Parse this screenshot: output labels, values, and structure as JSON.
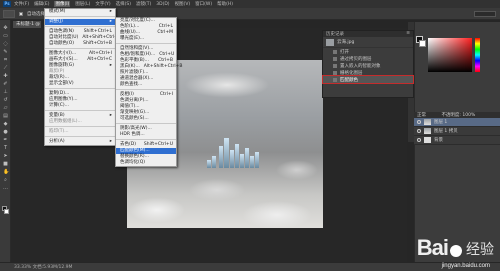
{
  "menubar": {
    "logo": "Ps",
    "items": [
      "文件(F)",
      "编辑(E)",
      "图像(I)",
      "图层(L)",
      "文字(Y)",
      "选择(S)",
      "滤镜(T)",
      "3D(D)",
      "视图(V)",
      "窗口(W)",
      "帮助(H)"
    ]
  },
  "optionsbar": {
    "auto_select_label": "自动选择:",
    "show_transform_label": "显示变换控件"
  },
  "document_tab": {
    "label": "未标题-1 @ 33.3%"
  },
  "image_menu": {
    "rows": [
      {
        "label": "模式(M)",
        "submenu": true
      },
      {
        "sep": true
      },
      {
        "label": "调整(J)",
        "submenu": true,
        "highlight": true
      },
      {
        "sep": true
      },
      {
        "label": "自动色调(N)",
        "shortcut": "Shift+Ctrl+L"
      },
      {
        "label": "自动对比度(U)",
        "shortcut": "Alt+Shift+Ctrl+L"
      },
      {
        "label": "自动颜色(O)",
        "shortcut": "Shift+Ctrl+B"
      },
      {
        "sep": true
      },
      {
        "label": "图像大小(I)...",
        "shortcut": "Alt+Ctrl+I"
      },
      {
        "label": "画布大小(S)...",
        "shortcut": "Alt+Ctrl+C"
      },
      {
        "label": "图像旋转(G)",
        "submenu": true
      },
      {
        "label": "裁剪(P)",
        "disabled": true
      },
      {
        "label": "裁切(R)..."
      },
      {
        "label": "显示全部(V)"
      },
      {
        "sep": true
      },
      {
        "label": "复制(D)..."
      },
      {
        "label": "应用图像(Y)..."
      },
      {
        "label": "计算(C)..."
      },
      {
        "sep": true
      },
      {
        "label": "变量(B)",
        "submenu": true
      },
      {
        "label": "应用数据组(L)...",
        "disabled": true
      },
      {
        "sep": true
      },
      {
        "label": "陷印(T)...",
        "disabled": true
      },
      {
        "sep": true
      },
      {
        "label": "分析(A)",
        "submenu": true
      }
    ]
  },
  "adjust_menu": {
    "rows": [
      {
        "label": "亮度/对比度(C)..."
      },
      {
        "label": "色阶(L)...",
        "shortcut": "Ctrl+L"
      },
      {
        "label": "曲线(U)...",
        "shortcut": "Ctrl+M"
      },
      {
        "label": "曝光度(E)..."
      },
      {
        "sep": true
      },
      {
        "label": "自然饱和度(V)..."
      },
      {
        "label": "色相/饱和度(H)...",
        "shortcut": "Ctrl+U"
      },
      {
        "label": "色彩平衡(B)...",
        "shortcut": "Ctrl+B"
      },
      {
        "label": "黑白(K)...",
        "shortcut": "Alt+Shift+Ctrl+B"
      },
      {
        "label": "照片滤镜(F)..."
      },
      {
        "label": "通道混合器(X)..."
      },
      {
        "label": "颜色查找..."
      },
      {
        "sep": true
      },
      {
        "label": "反相(I)",
        "shortcut": "Ctrl+I"
      },
      {
        "label": "色调分离(P)..."
      },
      {
        "label": "阈值(T)..."
      },
      {
        "label": "渐变映射(G)..."
      },
      {
        "label": "可选颜色(S)..."
      },
      {
        "sep": true
      },
      {
        "label": "阴影/高光(W)..."
      },
      {
        "label": "HDR 色调..."
      },
      {
        "sep": true
      },
      {
        "label": "去色(D)",
        "shortcut": "Shift+Ctrl+U"
      },
      {
        "label": "匹配颜色(M)...",
        "highlight": true
      },
      {
        "label": "替换颜色(R)..."
      },
      {
        "label": "色调均化(Q)"
      }
    ]
  },
  "history_panel": {
    "title": "历史记录",
    "snapshot_label": "云海.jpg",
    "rows": [
      "打开",
      "通过拷贝的图层",
      "置入嵌入的智能对象",
      "栅格化图层",
      "匹配颜色"
    ]
  },
  "layers_panel": {
    "blend_mode": "正常",
    "opacity": "不透明度: 100%",
    "rows": [
      "图层 1",
      "图层 1 拷贝",
      "背景"
    ]
  },
  "statusbar": {
    "text": "33.33%   文档:5.93M/12.9M"
  },
  "watermark": {
    "logo_left": "Bai",
    "logo_right": "经验",
    "url": "jingyan.baidu.com"
  }
}
